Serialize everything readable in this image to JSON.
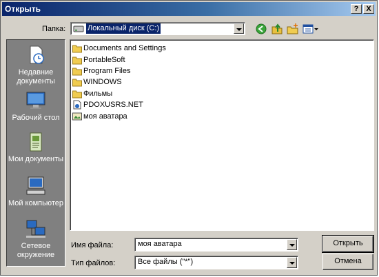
{
  "window": {
    "title": "Открыть",
    "help_glyph": "?",
    "close_glyph": "X"
  },
  "lookin": {
    "label": "Папка:",
    "value": "Локальный диск (C:)"
  },
  "toolbar": {
    "icons": [
      "back-icon",
      "up-folder-icon",
      "new-folder-icon",
      "views-menu-icon"
    ]
  },
  "places": [
    {
      "label": "Недавние документы",
      "icon": "recent-documents-icon"
    },
    {
      "label": "Рабочий стол",
      "icon": "desktop-icon"
    },
    {
      "label": "Мои документы",
      "icon": "my-documents-icon"
    },
    {
      "label": "Мой компьютер",
      "icon": "my-computer-icon"
    },
    {
      "label": "Сетевое окружение",
      "icon": "network-places-icon"
    }
  ],
  "files": [
    {
      "name": "Documents and Settings",
      "type": "folder"
    },
    {
      "name": "PortableSoft",
      "type": "folder"
    },
    {
      "name": "Program Files",
      "type": "folder"
    },
    {
      "name": "WINDOWS",
      "type": "folder"
    },
    {
      "name": "Фильмы",
      "type": "folder"
    },
    {
      "name": "PDOXUSRS.NET",
      "type": "net-file"
    },
    {
      "name": "моя аватара",
      "type": "image-file"
    }
  ],
  "filename": {
    "label": "Имя файла:",
    "value": "моя аватара"
  },
  "filetype": {
    "label": "Тип файлов:",
    "value": "Все файлы (\"*\")"
  },
  "buttons": {
    "open": "Открыть",
    "cancel": "Отмена"
  },
  "colors": {
    "title_start": "#0a246a",
    "title_end": "#a6caf0",
    "dialog_bg": "#d4d0c8",
    "places_bg": "#808080"
  }
}
